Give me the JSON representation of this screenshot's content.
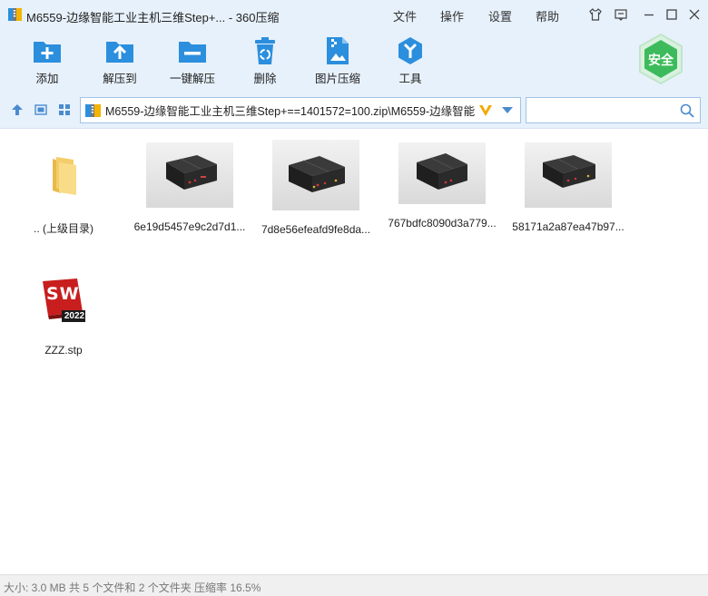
{
  "window": {
    "title": "M6559-边缘智能工业主机三维Step+... - 360压缩"
  },
  "menu": {
    "file": "文件",
    "operate": "操作",
    "settings": "设置",
    "help": "帮助"
  },
  "toolbar": {
    "add": "添加",
    "extract_to": "解压到",
    "one_click_extract": "一键解压",
    "delete": "删除",
    "image_compress": "图片压缩",
    "tools": "工具",
    "safe_badge": "安全"
  },
  "address": {
    "path": "M6559-边缘智能工业主机三维Step+==1401572=100.zip\\M6559-边缘智能",
    "search_placeholder": ""
  },
  "files": [
    {
      "name": ".. (上级目录)",
      "kind": "parent-folder"
    },
    {
      "name": "6e19d5457e9c2d7d1...",
      "kind": "image"
    },
    {
      "name": "7d8e56efeafd9fe8da...",
      "kind": "image"
    },
    {
      "name": "767bdfc8090d3a779...",
      "kind": "image"
    },
    {
      "name": "58171a2a87ea47b97...",
      "kind": "image"
    },
    {
      "name": "ZZZ.stp",
      "kind": "solidworks-file",
      "badge": "2022",
      "logo": "SW"
    }
  ],
  "status": {
    "text": "大小: 3.0 MB 共 5 个文件和 2 个文件夹 压缩率 16.5%"
  },
  "colors": {
    "chrome_bg": "#e7f1fb",
    "accent_blue": "#2b8fde",
    "safe_green": "#3dbb5c"
  }
}
